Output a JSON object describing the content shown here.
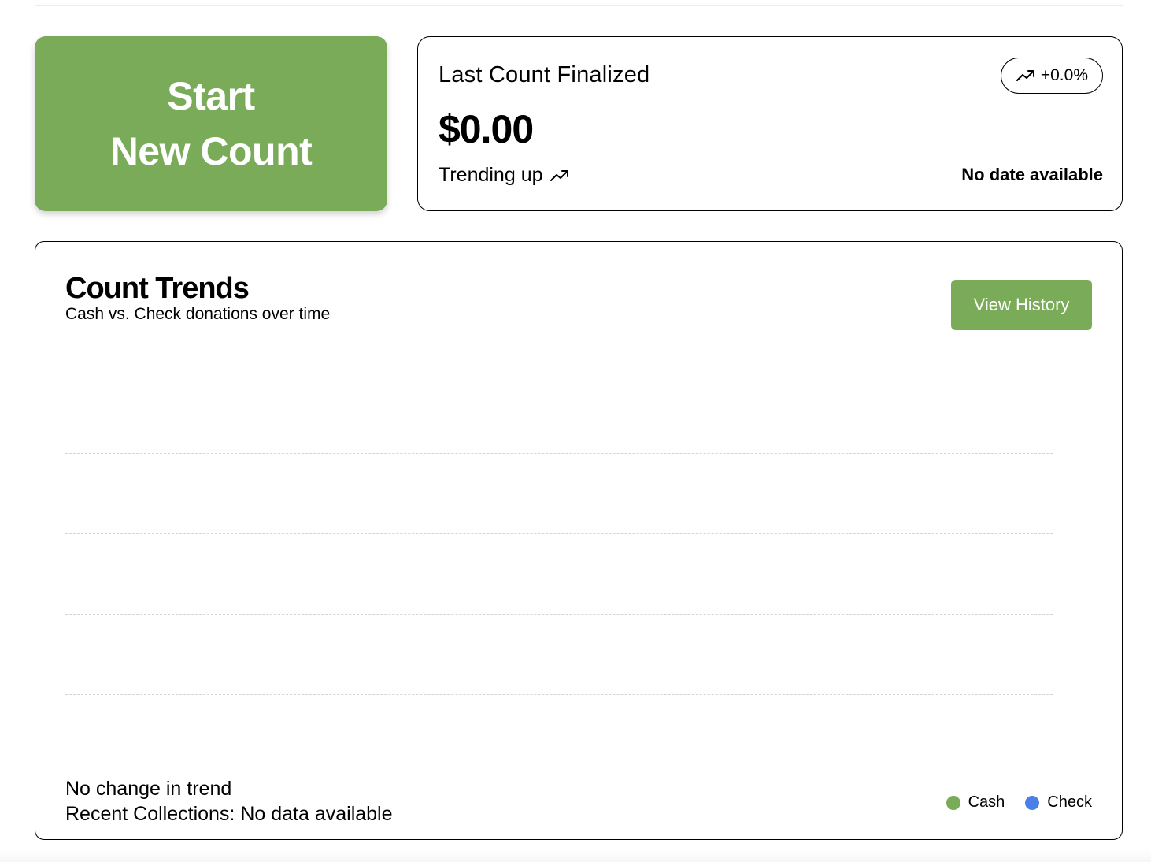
{
  "start_button": {
    "line1": "Start",
    "line2": "New Count"
  },
  "last_count": {
    "title": "Last Count Finalized",
    "amount": "$0.00",
    "trend_text": "Trending up",
    "trend_icon": "trending-up-icon",
    "badge_text": "+0.0%",
    "date_text": "No date available"
  },
  "count_trends": {
    "title": "Count Trends",
    "subtitle": "Cash vs. Check donations over time",
    "view_history_label": "View History",
    "trend_note": "No change in trend",
    "recent_collections": "Recent Collections: No data available",
    "legend": [
      {
        "label": "Cash",
        "color": "#7aab59"
      },
      {
        "label": "Check",
        "color": "#4a7fe8"
      }
    ]
  },
  "colors": {
    "accent_green": "#7aab59",
    "check_blue": "#4a7fe8",
    "gridline": "#d4d4d4"
  },
  "chart_data": {
    "type": "line",
    "series": [
      {
        "name": "Cash",
        "values": []
      },
      {
        "name": "Check",
        "values": []
      }
    ],
    "categories": [],
    "grid": true,
    "legend": "bottom-right"
  }
}
